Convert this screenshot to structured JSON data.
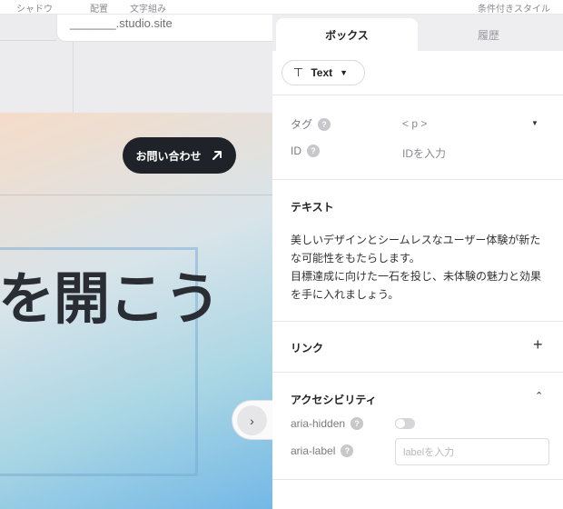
{
  "topbar": {
    "items": [
      "シャドウ",
      "配置",
      "文字組み"
    ],
    "right_label": "条件付きスタイル"
  },
  "canvas": {
    "url": "_______.studio.site",
    "contact_button": "お問い合わせ",
    "headline": "を開こう"
  },
  "panel": {
    "tabs": [
      "ボックス",
      "履歴"
    ],
    "element_type": "Text",
    "tag_label": "タグ",
    "tag_value": "< p >",
    "id_label": "ID",
    "id_placeholder": "IDを入力",
    "text_section_title": "テキスト",
    "text_content": "美しいデザインとシームレスなユーザー体験が新たな可能性をもたらします。\n目標達成に向けた一石を投じ、未体験の魅力と効果を手に入れましょう。",
    "link_section_title": "リンク",
    "accessibility_title": "アクセシビリティ",
    "aria_hidden_label": "aria-hidden",
    "aria_hidden_value": false,
    "aria_label_label": "aria-label",
    "aria_label_placeholder": "labelを入力"
  },
  "colors": {
    "button_dark": "#1f2329",
    "panel_bg": "#ffffff",
    "tab_bg": "#eeeef0"
  }
}
